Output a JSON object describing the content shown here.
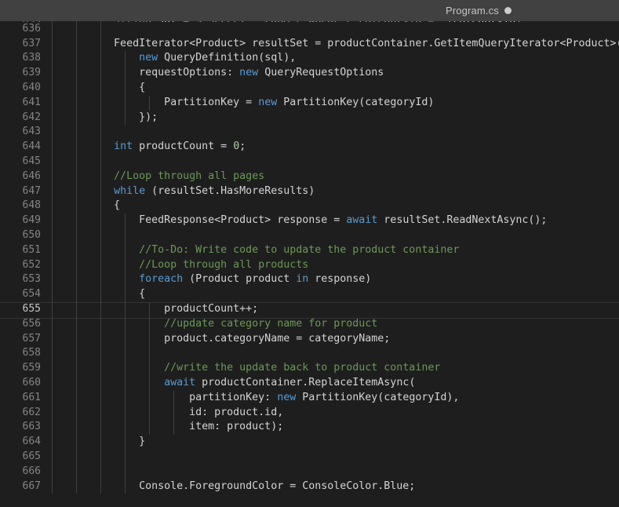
{
  "window": {
    "title": "Program.cs",
    "background": "#1e1e1e"
  },
  "tabbar": {
    "background": "#414141",
    "active_tab": {
      "label": "Program.cs",
      "dirty_indicator": "modified-dot",
      "dirty": true
    }
  },
  "editor": {
    "language": "csharp",
    "theme": "dark-plus",
    "font_size": "13px",
    "line_height": 18.8,
    "active_line": 655,
    "first_visible_line": 635,
    "last_visible_line": 667,
    "colors": {
      "background": "#1e1e1e",
      "foreground": "#d4d4d4",
      "keyword": "#569cd6",
      "comment": "#6a9955",
      "string": "#ce9178",
      "number": "#b5cea8",
      "line_number": "#858585",
      "line_number_active": "#c6c6c6",
      "indent_guide": "#404040",
      "current_line_border": "#333436"
    },
    "indent_guide_columns": [
      66,
      97,
      128,
      159,
      190
    ],
    "lines": [
      {
        "n": 635,
        "clipped": true,
        "guides": [
          66,
          97,
          128
        ],
        "tokens": [
          {
            "t": "          ",
            "c": "pl"
          },
          {
            "t": "string",
            "c": "kw"
          },
          {
            "t": " sql = ",
            "c": "pl"
          },
          {
            "t": "$\"SELECT * FROM c WHERE c.categoryId = '{",
            "c": "str"
          },
          {
            "t": "categoryId",
            "c": "pl"
          },
          {
            "t": "}'\";",
            "c": "str"
          }
        ]
      },
      {
        "n": 636,
        "guides": [
          66,
          97,
          128
        ],
        "tokens": []
      },
      {
        "n": 637,
        "guides": [
          66,
          97,
          128
        ],
        "tokens": [
          {
            "t": "          FeedIterator<Product> resultSet = productContainer.GetItemQueryIterator<Product>(",
            "c": "pl"
          }
        ]
      },
      {
        "n": 638,
        "guides": [
          66,
          97,
          128,
          159
        ],
        "tokens": [
          {
            "t": "              ",
            "c": "pl"
          },
          {
            "t": "new",
            "c": "kw"
          },
          {
            "t": " QueryDefinition(sql),",
            "c": "pl"
          }
        ]
      },
      {
        "n": 639,
        "guides": [
          66,
          97,
          128,
          159
        ],
        "tokens": [
          {
            "t": "              requestOptions: ",
            "c": "pl"
          },
          {
            "t": "new",
            "c": "kw"
          },
          {
            "t": " QueryRequestOptions",
            "c": "pl"
          }
        ]
      },
      {
        "n": 640,
        "guides": [
          66,
          97,
          128,
          159
        ],
        "tokens": [
          {
            "t": "              {",
            "c": "pl"
          }
        ]
      },
      {
        "n": 641,
        "guides": [
          66,
          97,
          128,
          159,
          190
        ],
        "tokens": [
          {
            "t": "                  PartitionKey = ",
            "c": "pl"
          },
          {
            "t": "new",
            "c": "kw"
          },
          {
            "t": " PartitionKey(categoryId)",
            "c": "pl"
          }
        ]
      },
      {
        "n": 642,
        "guides": [
          66,
          97,
          128,
          159
        ],
        "tokens": [
          {
            "t": "              });",
            "c": "pl"
          }
        ]
      },
      {
        "n": 643,
        "guides": [
          66,
          97,
          128
        ],
        "tokens": []
      },
      {
        "n": 644,
        "guides": [
          66,
          97,
          128
        ],
        "tokens": [
          {
            "t": "          ",
            "c": "pl"
          },
          {
            "t": "int",
            "c": "kw"
          },
          {
            "t": " productCount = ",
            "c": "pl"
          },
          {
            "t": "0",
            "c": "num"
          },
          {
            "t": ";",
            "c": "pl"
          }
        ]
      },
      {
        "n": 645,
        "guides": [
          66,
          97,
          128
        ],
        "tokens": []
      },
      {
        "n": 646,
        "guides": [
          66,
          97,
          128
        ],
        "tokens": [
          {
            "t": "          //Loop through all pages",
            "c": "cm"
          }
        ]
      },
      {
        "n": 647,
        "guides": [
          66,
          97,
          128
        ],
        "tokens": [
          {
            "t": "          ",
            "c": "pl"
          },
          {
            "t": "while",
            "c": "kw"
          },
          {
            "t": " (resultSet.HasMoreResults)",
            "c": "pl"
          }
        ]
      },
      {
        "n": 648,
        "guides": [
          66,
          97,
          128
        ],
        "tokens": [
          {
            "t": "          {",
            "c": "pl"
          }
        ]
      },
      {
        "n": 649,
        "guides": [
          66,
          97,
          128,
          159
        ],
        "tokens": [
          {
            "t": "              FeedResponse<Product> response = ",
            "c": "pl"
          },
          {
            "t": "await",
            "c": "kw"
          },
          {
            "t": " resultSet.ReadNextAsync();",
            "c": "pl"
          }
        ]
      },
      {
        "n": 650,
        "guides": [
          66,
          97,
          128,
          159
        ],
        "tokens": []
      },
      {
        "n": 651,
        "guides": [
          66,
          97,
          128,
          159
        ],
        "tokens": [
          {
            "t": "              //To-Do: Write code to update the product container",
            "c": "cm"
          }
        ]
      },
      {
        "n": 652,
        "guides": [
          66,
          97,
          128,
          159
        ],
        "tokens": [
          {
            "t": "              //Loop through all products",
            "c": "cm"
          }
        ]
      },
      {
        "n": 653,
        "guides": [
          66,
          97,
          128,
          159
        ],
        "tokens": [
          {
            "t": "              ",
            "c": "pl"
          },
          {
            "t": "foreach",
            "c": "kw"
          },
          {
            "t": " (Product product ",
            "c": "pl"
          },
          {
            "t": "in",
            "c": "kw"
          },
          {
            "t": " response)",
            "c": "pl"
          }
        ]
      },
      {
        "n": 654,
        "guides": [
          66,
          97,
          128,
          159
        ],
        "tokens": [
          {
            "t": "              {",
            "c": "pl"
          }
        ]
      },
      {
        "n": 655,
        "active": true,
        "guides": [
          66,
          97,
          128,
          159,
          190
        ],
        "tokens": [
          {
            "t": "                  productCount++;",
            "c": "pl"
          }
        ]
      },
      {
        "n": 656,
        "guides": [
          66,
          97,
          128,
          159,
          190
        ],
        "tokens": [
          {
            "t": "                  //update category name for product",
            "c": "cm"
          }
        ]
      },
      {
        "n": 657,
        "guides": [
          66,
          97,
          128,
          159,
          190
        ],
        "tokens": [
          {
            "t": "                  product.categoryName = categoryName;",
            "c": "pl"
          }
        ]
      },
      {
        "n": 658,
        "guides": [
          66,
          97,
          128,
          159,
          190
        ],
        "tokens": []
      },
      {
        "n": 659,
        "guides": [
          66,
          97,
          128,
          159,
          190
        ],
        "tokens": [
          {
            "t": "                  //write the update back to product container",
            "c": "cm"
          }
        ]
      },
      {
        "n": 660,
        "guides": [
          66,
          97,
          128,
          159,
          190
        ],
        "tokens": [
          {
            "t": "                  ",
            "c": "pl"
          },
          {
            "t": "await",
            "c": "kw"
          },
          {
            "t": " productContainer.ReplaceItemAsync(",
            "c": "pl"
          }
        ]
      },
      {
        "n": 661,
        "guides": [
          66,
          97,
          128,
          159,
          190,
          221
        ],
        "tokens": [
          {
            "t": "                      partitionKey: ",
            "c": "pl"
          },
          {
            "t": "new",
            "c": "kw"
          },
          {
            "t": " PartitionKey(categoryId),",
            "c": "pl"
          }
        ]
      },
      {
        "n": 662,
        "guides": [
          66,
          97,
          128,
          159,
          190,
          221
        ],
        "tokens": [
          {
            "t": "                      id: product.id,",
            "c": "pl"
          }
        ]
      },
      {
        "n": 663,
        "guides": [
          66,
          97,
          128,
          159,
          190,
          221
        ],
        "tokens": [
          {
            "t": "                      item: product);",
            "c": "pl"
          }
        ]
      },
      {
        "n": 664,
        "guides": [
          66,
          97,
          128,
          159
        ],
        "tokens": [
          {
            "t": "              }",
            "c": "pl"
          }
        ]
      },
      {
        "n": 665,
        "guides": [
          66,
          97,
          128,
          159
        ],
        "tokens": []
      },
      {
        "n": 666,
        "guides": [
          66,
          97,
          128,
          159
        ],
        "tokens": []
      },
      {
        "n": 667,
        "guides": [
          66,
          97,
          128,
          159
        ],
        "tokens": [
          {
            "t": "              Console.ForegroundColor = ConsoleColor.Blue;",
            "c": "pl"
          }
        ]
      }
    ]
  }
}
